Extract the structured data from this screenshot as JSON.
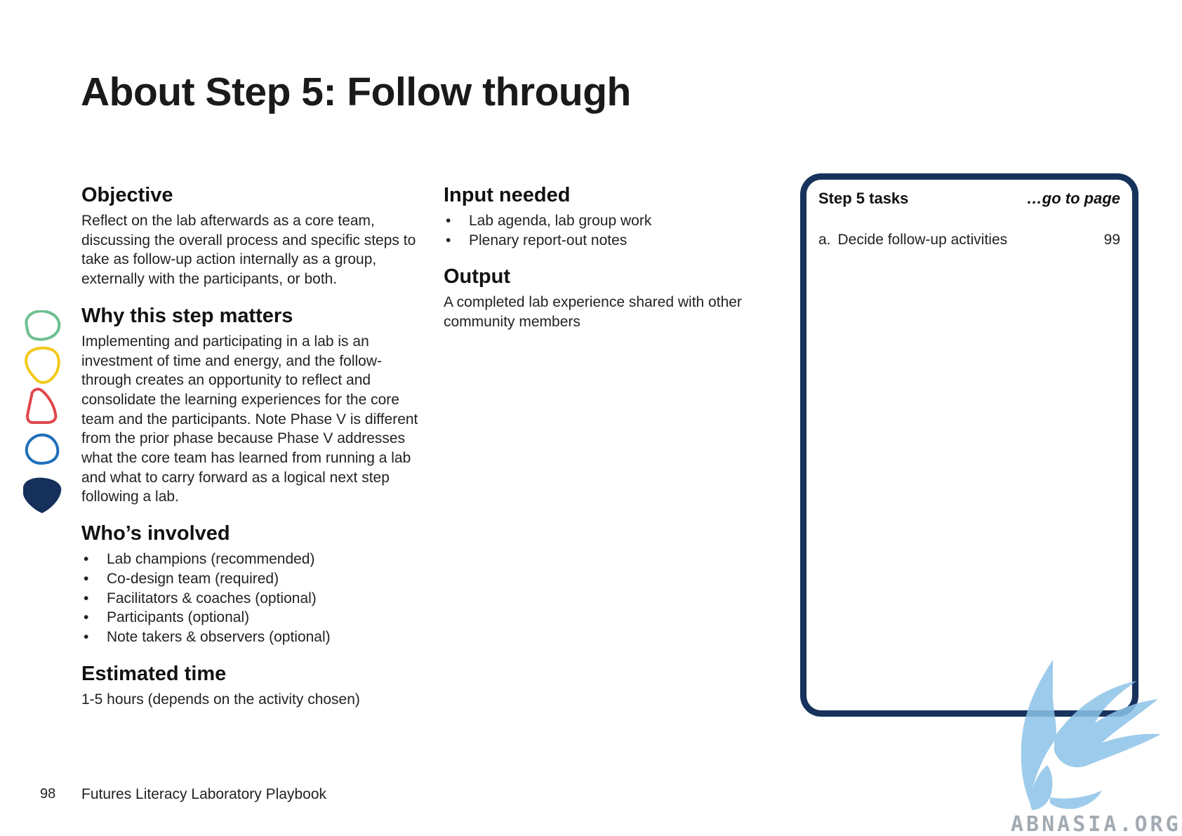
{
  "page": {
    "title": "About Step 5: Follow through",
    "page_number": "98",
    "footer_title": "Futures Literacy Laboratory Playbook"
  },
  "left": {
    "objective_heading": "Objective",
    "objective_text": "Reflect on the lab afterwards as a core team, discussing the overall process and specific steps to take as follow-up action internally as a group, externally with the participants, or both.",
    "why_heading": "Why this step matters",
    "why_text": "Implementing and participating in a lab is an investment of time and energy, and the follow-through creates an opportunity to reflect and consolidate the learning experiences for the core team and the participants. Note Phase V is different from the prior phase because Phase V addresses what the core team has learned from running a lab and what to carry forward as a logical next step following a lab.",
    "who_heading": "Who’s involved",
    "who_items": [
      "Lab champions (recommended)",
      "Co-design team (required)",
      "Facilitators & coaches (optional)",
      "Participants (optional)",
      "Note takers & observers (optional)"
    ],
    "time_heading": "Estimated time",
    "time_text": "1-5 hours (depends on the activity chosen)"
  },
  "middle": {
    "input_heading": "Input needed",
    "input_items": [
      "Lab agenda, lab group work",
      "Plenary report-out notes"
    ],
    "output_heading": "Output",
    "output_text": "A completed lab experience shared with other community members"
  },
  "tasks": {
    "title": "Step 5 tasks",
    "goto_label": "…go to page",
    "items": [
      {
        "letter": "a.",
        "label": "Decide follow-up activities",
        "page": "99"
      }
    ]
  },
  "side_icons": [
    {
      "name": "green-outline-blob-icon",
      "color": "#6dbf91",
      "filled": false
    },
    {
      "name": "yellow-outline-blob-icon",
      "color": "#f2c91d",
      "filled": false
    },
    {
      "name": "red-outline-blob-icon",
      "color": "#e0474b",
      "filled": false
    },
    {
      "name": "blue-outline-blob-icon",
      "color": "#1f6fb8",
      "filled": false
    },
    {
      "name": "navy-filled-blob-icon",
      "color": "#15305a",
      "filled": true
    }
  ],
  "watermark": {
    "text": "ABNASIA.ORG",
    "color": "#7fb8e2"
  },
  "colors": {
    "panel_border": "#17325c"
  }
}
